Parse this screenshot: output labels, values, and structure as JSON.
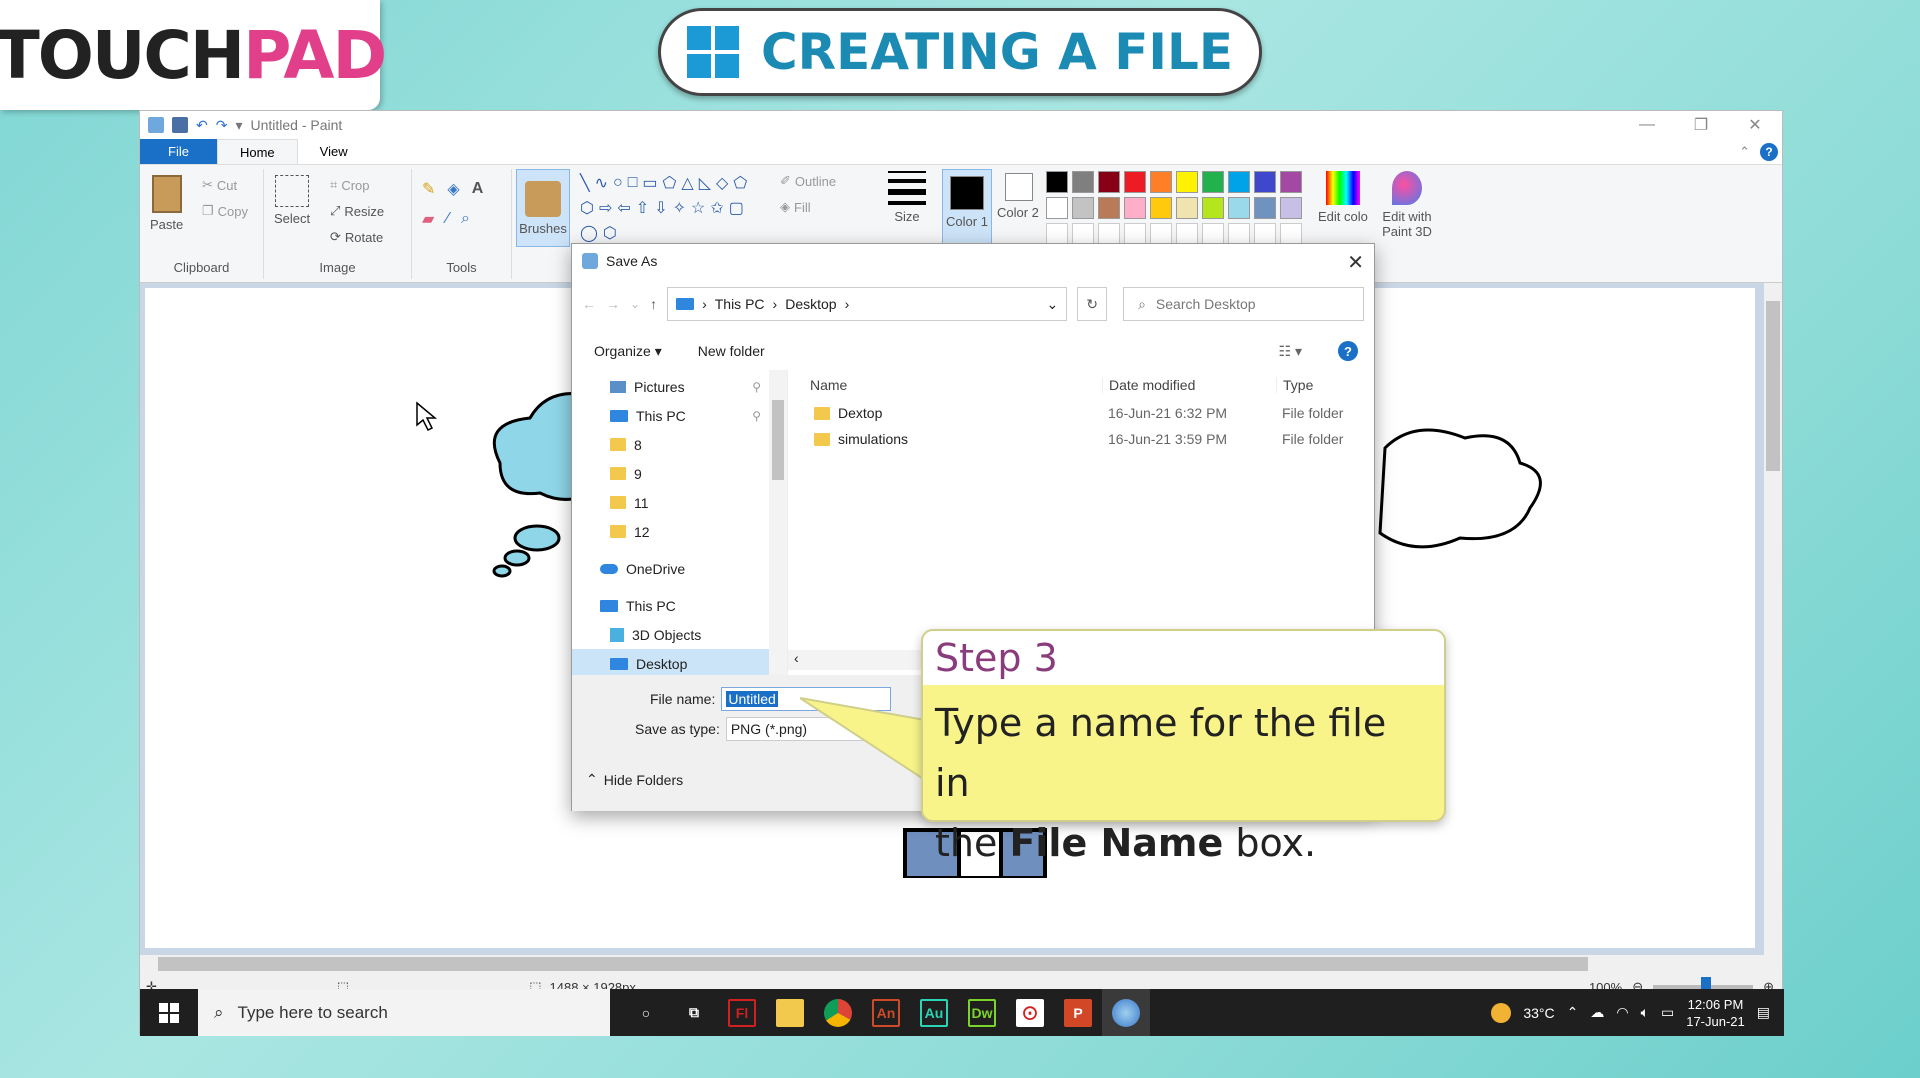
{
  "logo": {
    "part1": "TOUCH",
    "part2": "PAD"
  },
  "banner": {
    "title": "CREATING A FILE"
  },
  "paint": {
    "window_title": "Untitled - Paint",
    "tabs": [
      "File",
      "Home",
      "View"
    ],
    "clipboard": {
      "paste": "Paste",
      "cut": "Cut",
      "copy": "Copy",
      "label": "Clipboard"
    },
    "image": {
      "select": "Select",
      "crop": "Crop",
      "resize": "Resize",
      "rotate": "Rotate",
      "label": "Image"
    },
    "tools": {
      "label": "Tools",
      "brushes": "Brushes"
    },
    "shapes": {
      "outline": "Outline",
      "fill": "Fill"
    },
    "size": "Size",
    "color1": "Color 1",
    "color2": "Color 2",
    "edit_colors": "Edit colors",
    "paint3d": "Edit with Paint 3D",
    "palette": [
      "#000000",
      "#7f7f7f",
      "#880015",
      "#ed1c24",
      "#ff7f27",
      "#fff200",
      "#22b14c",
      "#00a2e8",
      "#3f48cc",
      "#a349a4",
      "#ffffff",
      "#c3c3c3",
      "#b97a57",
      "#ffaec9",
      "#ffc90e",
      "#efe4b0",
      "#b5e61d",
      "#99d9ea",
      "#7092be",
      "#c8bfe7"
    ],
    "status": {
      "dimensions": "1488 × 1928px",
      "zoom": "100%"
    }
  },
  "dialog": {
    "title": "Save As",
    "breadcrumb": [
      "This PC",
      "Desktop"
    ],
    "search_placeholder": "Search Desktop",
    "organize": "Organize",
    "new_folder": "New folder",
    "nav": [
      {
        "label": "Pictures",
        "type": "pictures"
      },
      {
        "label": "This PC",
        "type": "pc"
      },
      {
        "label": "8",
        "type": "folder"
      },
      {
        "label": "9",
        "type": "folder"
      },
      {
        "label": "11",
        "type": "folder"
      },
      {
        "label": "12",
        "type": "folder"
      },
      {
        "label": "OneDrive",
        "type": "cloud"
      },
      {
        "label": "This PC",
        "type": "pc"
      },
      {
        "label": "3D Objects",
        "type": "3d"
      },
      {
        "label": "Desktop",
        "type": "pc"
      }
    ],
    "columns": {
      "name": "Name",
      "date": "Date modified",
      "type": "Type"
    },
    "files": [
      {
        "name": "Dextop",
        "date": "16-Jun-21 6:32 PM",
        "type": "File folder"
      },
      {
        "name": "simulations",
        "date": "16-Jun-21 3:59 PM",
        "type": "File folder"
      }
    ],
    "file_name_label": "File name:",
    "file_name_value": "Untitled",
    "save_type_label": "Save as type:",
    "save_type_value": "PNG (*.png)",
    "hide_folders": "Hide Folders"
  },
  "callout": {
    "head": "Step 3",
    "line1": "Type a name for the file in",
    "line2a": "the ",
    "line2b": "File Name",
    "line2c": " box."
  },
  "taskbar": {
    "search": "Type here to search",
    "apps": [
      "Fl",
      "",
      "",
      "An",
      "Au",
      "Dw",
      "",
      "P",
      ""
    ],
    "temp": "33°C",
    "time": "12:06 PM",
    "date": "17-Jun-21"
  }
}
